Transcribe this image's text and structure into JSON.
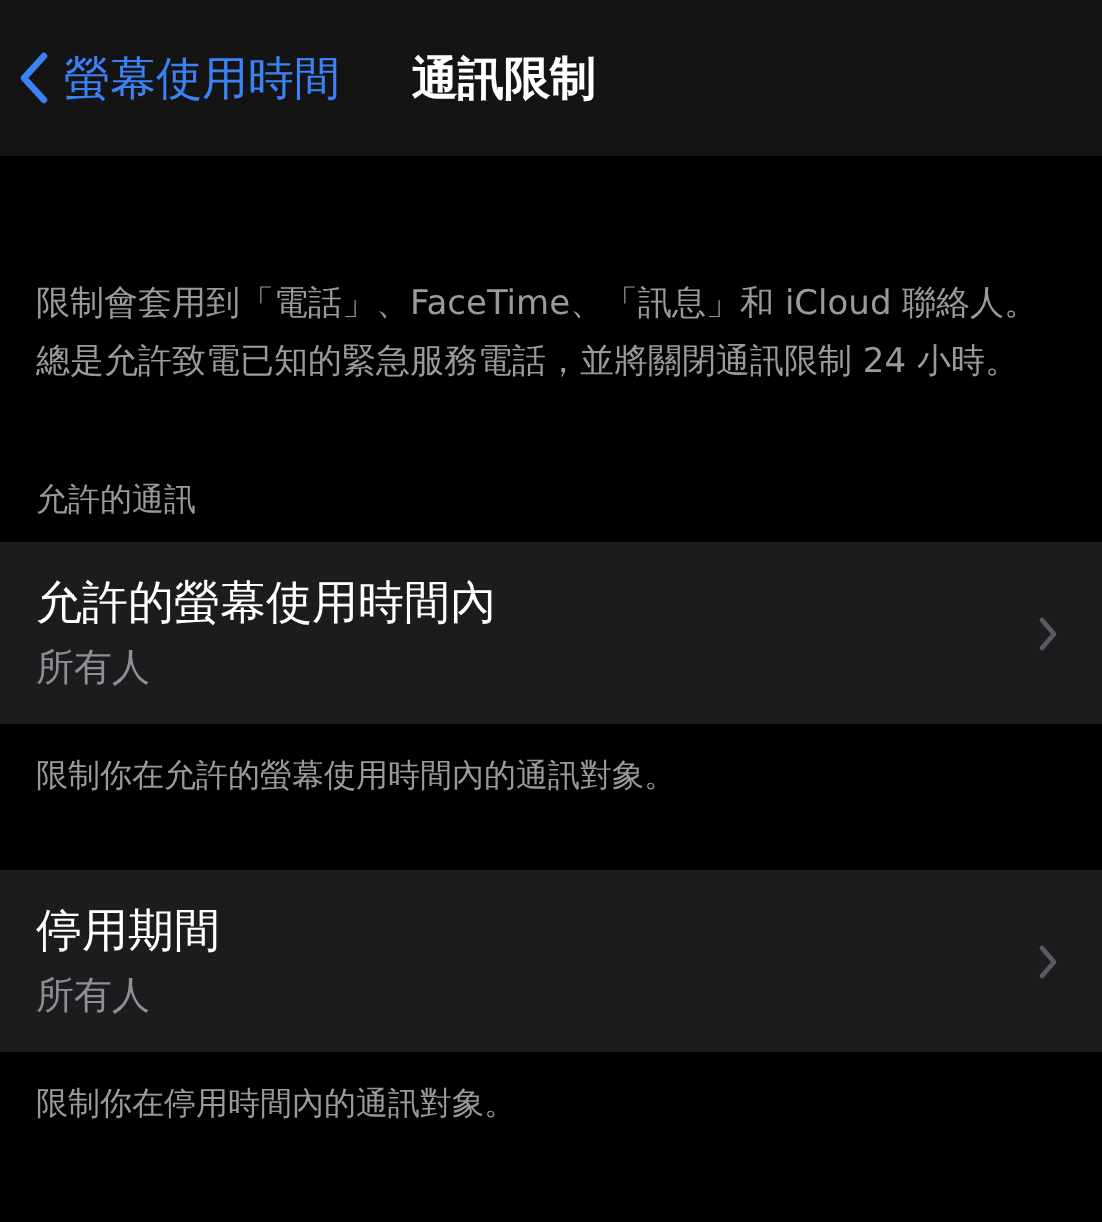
{
  "nav": {
    "back_label": "螢幕使用時間",
    "title": "通訊限制"
  },
  "intro": "限制會套用到「電話」、FaceTime、「訊息」和 iCloud 聯絡人。總是允許致電已知的緊急服務電話，並將關閉通訊限制 24 小時。",
  "section_header": "允許的通訊",
  "groups": [
    {
      "title": "允許的螢幕使用時間內",
      "value": "所有人",
      "footer": "限制你在允許的螢幕使用時間內的通訊對象。"
    },
    {
      "title": "停用期間",
      "value": "所有人",
      "footer": "限制你在停用時間內的通訊對象。"
    }
  ]
}
